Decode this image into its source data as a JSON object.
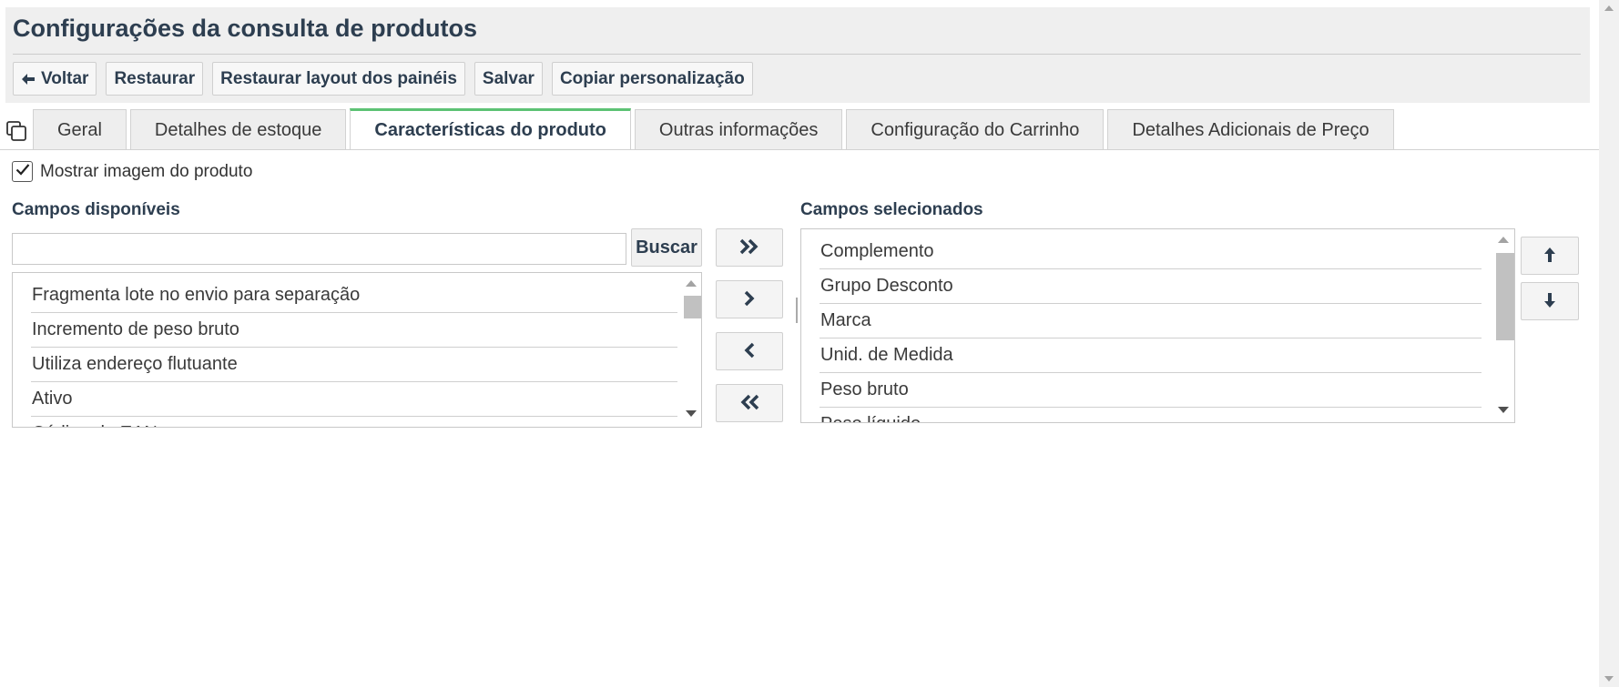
{
  "page": {
    "title": "Configurações da consulta de produtos"
  },
  "toolbar": {
    "back_label": "Voltar",
    "restore_label": "Restaurar",
    "restore_layout_label": "Restaurar layout dos painéis",
    "save_label": "Salvar",
    "copy_label": "Copiar personalização"
  },
  "tabs": [
    {
      "label": "Geral",
      "active": false
    },
    {
      "label": "Detalhes de estoque",
      "active": false
    },
    {
      "label": "Características do produto",
      "active": true
    },
    {
      "label": "Outras informações",
      "active": false
    },
    {
      "label": "Configuração do Carrinho",
      "active": false
    },
    {
      "label": "Detalhes Adicionais de Preço",
      "active": false
    }
  ],
  "show_image": {
    "label": "Mostrar imagem do produto",
    "checked": true
  },
  "available": {
    "title": "Campos disponíveis",
    "search_value": "",
    "search_button": "Buscar",
    "items": [
      "Fragmenta lote no envio para separação",
      "Incremento de peso bruto",
      "Utiliza endereço flutuante",
      "Ativo",
      "Código de EAN"
    ]
  },
  "selected": {
    "title": "Campos selecionados",
    "items": [
      "Complemento",
      "Grupo Desconto",
      "Marca",
      "Unid. de Medida",
      "Peso bruto",
      "Peso líquido"
    ]
  },
  "icons": {
    "back": "arrow-left-icon",
    "copy": "copy-icon",
    "move_all_right": "double-chevron-right-icon",
    "move_right": "chevron-right-icon",
    "move_left": "chevron-left-icon",
    "move_all_left": "double-chevron-left-icon",
    "move_up": "arrow-up-icon",
    "move_down": "arrow-down-icon",
    "checkmark": "checkmark-icon"
  },
  "colors": {
    "title": "#2d3e50",
    "active_tab_accent": "#5cc274",
    "header_bg": "#efefef"
  }
}
